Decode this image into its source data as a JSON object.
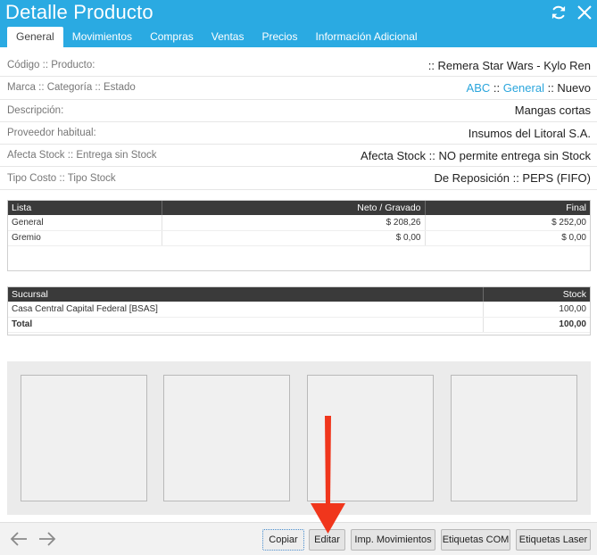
{
  "window": {
    "title": "Detalle Producto",
    "icons": {
      "refresh": "refresh-icon",
      "close": "close-icon"
    }
  },
  "tabs": [
    {
      "label": "General",
      "active": true
    },
    {
      "label": "Movimientos"
    },
    {
      "label": "Compras"
    },
    {
      "label": "Ventas"
    },
    {
      "label": "Precios"
    },
    {
      "label": "Información Adicional"
    }
  ],
  "details": {
    "codigo": {
      "label": "Código :: Producto:",
      "value": ":: Remera Star Wars - Kylo Ren"
    },
    "marca": {
      "label": "Marca :: Categoría :: Estado",
      "marca": "ABC",
      "sep1": " :: ",
      "categoria": "General",
      "sep2": " :: ",
      "estado": "Nuevo"
    },
    "descripcion": {
      "label": "Descripción:",
      "value": "Mangas cortas"
    },
    "proveedor": {
      "label": "Proveedor habitual:",
      "value": "Insumos del Litoral S.A."
    },
    "stock": {
      "label": "Afecta Stock :: Entrega sin Stock",
      "value": "Afecta Stock :: NO permite entrega sin Stock"
    },
    "costo": {
      "label": "Tipo Costo :: Tipo Stock",
      "value": "De Reposición :: PEPS (FIFO)"
    }
  },
  "precios": {
    "headers": {
      "lista": "Lista",
      "neto": "Neto / Gravado",
      "final": "Final"
    },
    "rows": [
      {
        "lista": "General",
        "neto": "$ 208,26",
        "final": "$ 252,00"
      },
      {
        "lista": "Gremio",
        "neto": "$ 0,00",
        "final": "$ 0,00"
      }
    ]
  },
  "stock_table": {
    "headers": {
      "sucursal": "Sucursal",
      "stock": "Stock"
    },
    "rows": [
      {
        "sucursal": "Casa Central Capital Federal [BSAS]",
        "stock": "100,00"
      }
    ],
    "total": {
      "label": "Total",
      "value": "100,00"
    }
  },
  "footer": {
    "nav": {
      "prev": "arrow-left-icon",
      "next": "arrow-right-icon"
    },
    "buttons": {
      "copiar": "Copiar",
      "editar": "Editar",
      "imp_movimientos": "Imp. Movimientos",
      "etiquetas_com": "Etiquetas COM",
      "etiquetas_laser": "Etiquetas Laser"
    }
  },
  "colors": {
    "header": "#2aaae2",
    "link": "#2aa5dc",
    "table_header": "#3a3a3a",
    "annotation_arrow": "#f0361c"
  }
}
